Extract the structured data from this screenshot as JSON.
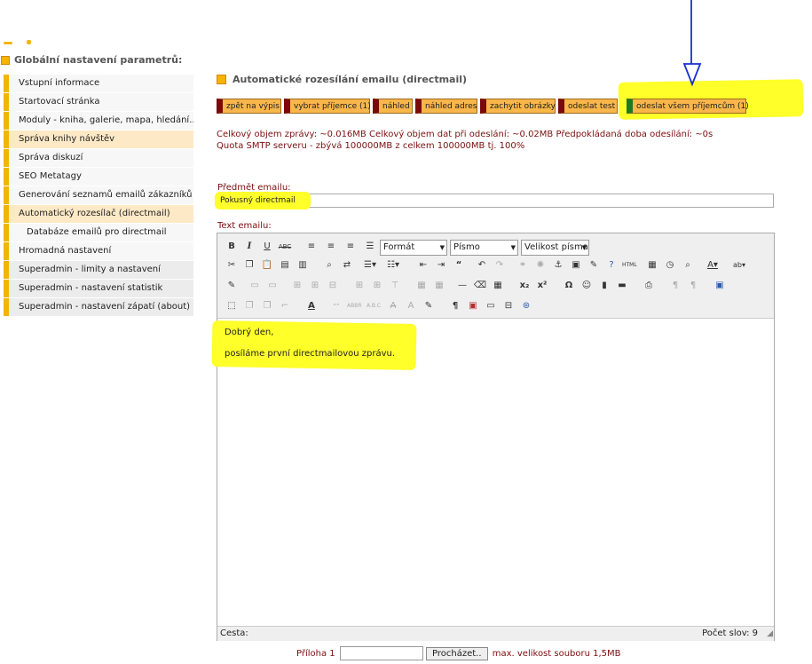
{
  "sidebar": {
    "heading": "Globální nastavení parametrů:",
    "items": [
      {
        "label": "Vstupní informace"
      },
      {
        "label": "Startovací stránka"
      },
      {
        "label": "Moduly - kniha, galerie, mapa, hledání.."
      },
      {
        "label": "Správa knihy návštěv"
      },
      {
        "label": "Správa diskuzí"
      },
      {
        "label": "SEO Metatagy"
      },
      {
        "label": "Generování seznamů emailů zákazníků"
      },
      {
        "label": "Automatický rozesílač (directmail)"
      },
      {
        "label": "Databáze emailů pro directmail"
      },
      {
        "label": "Hromadná nastavení"
      },
      {
        "label": "Superadmin - limity a nastavení"
      },
      {
        "label": "Superadmin - nastavení statistik"
      },
      {
        "label": "Superadmin - nastavení zápatí (about)"
      }
    ]
  },
  "main": {
    "title": "Automatické rozesílání emailu (directmail)",
    "buttons": [
      {
        "label": "zpět na výpis"
      },
      {
        "label": "vybrat příjemce (1)"
      },
      {
        "label": "náhled"
      },
      {
        "label": "náhled adres"
      },
      {
        "label": "zachytit obrázky"
      },
      {
        "label": "odeslat test"
      },
      {
        "label": "odeslat všem příjemcům (1)"
      }
    ],
    "info_line1": "Celkový objem zprávy: ~0.016MB  Celkový objem dat při odeslání: ~0.02MB  Předpokládaná doba odesílání: ~0s",
    "info_line2": "Quota SMTP serveru - zbývá 100000MB z celkem 100000MB tj. 100%",
    "subject_label": "Předmět emailu:",
    "subject_value": "Pokusný directmail",
    "body_label": "Text emailu:",
    "editor": {
      "format_label": "Formát",
      "font_label": "Písmo",
      "size_label": "Velikost písma",
      "content_line1": "Dobrý den,",
      "content_line2": "posíláme první directmailovou zprávu.",
      "path_label": "Cesta:",
      "word_count": "Počet slov: 9"
    },
    "attachment": {
      "label": "Příloha 1",
      "browse_label": "Procházet..",
      "max_size": "max. velikost souboru 1,5MB"
    }
  },
  "colors": {
    "accent": "#f5b400",
    "highlight": "#ffff2a",
    "button_bg": "#f9b64a",
    "text_dark_red": "#7a1010",
    "annotation_arrow": "#1a2fd0"
  }
}
